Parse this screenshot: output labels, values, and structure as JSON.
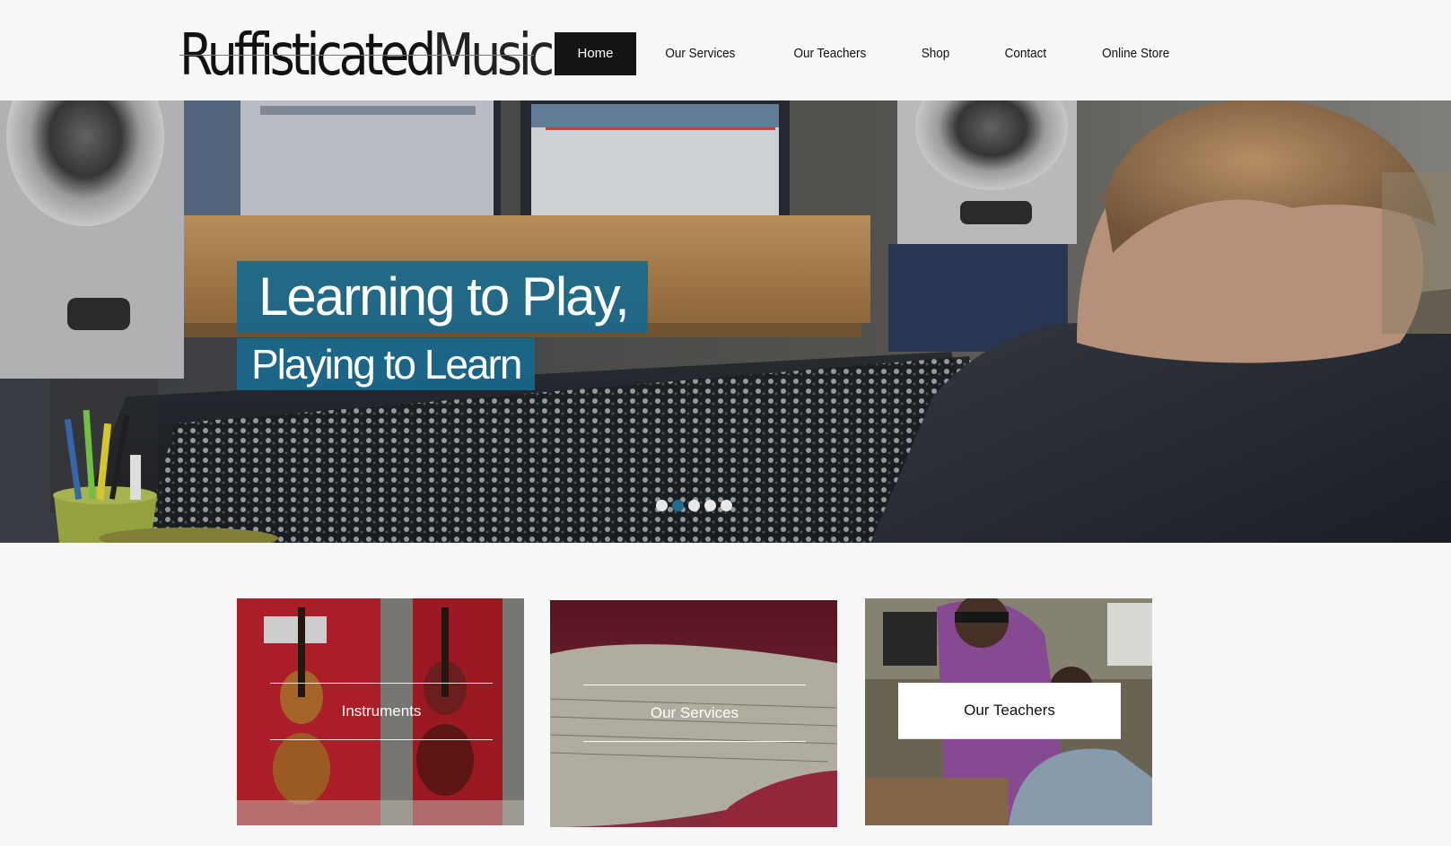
{
  "logo": {
    "part1": "Ruffisticated",
    "part2": "Music"
  },
  "nav": {
    "items": [
      {
        "label": "Home",
        "active": true
      },
      {
        "label": "Our Services",
        "active": false
      },
      {
        "label": "Our Teachers",
        "active": false
      },
      {
        "label": "Shop",
        "active": false
      },
      {
        "label": "Contact",
        "active": false
      },
      {
        "label": "Online Store",
        "active": false
      }
    ]
  },
  "hero": {
    "title_line1": "Learning to Play,",
    "title_line2": "Playing to Learn",
    "slide_count": 5,
    "active_slide": 2
  },
  "cards": [
    {
      "label": "Instruments"
    },
    {
      "label": "Our Services"
    },
    {
      "label": "Our Teachers"
    }
  ],
  "colors": {
    "accent_blue": "#1e6d91",
    "nav_active_bg": "#141414",
    "page_bg": "#f7f7f7"
  }
}
